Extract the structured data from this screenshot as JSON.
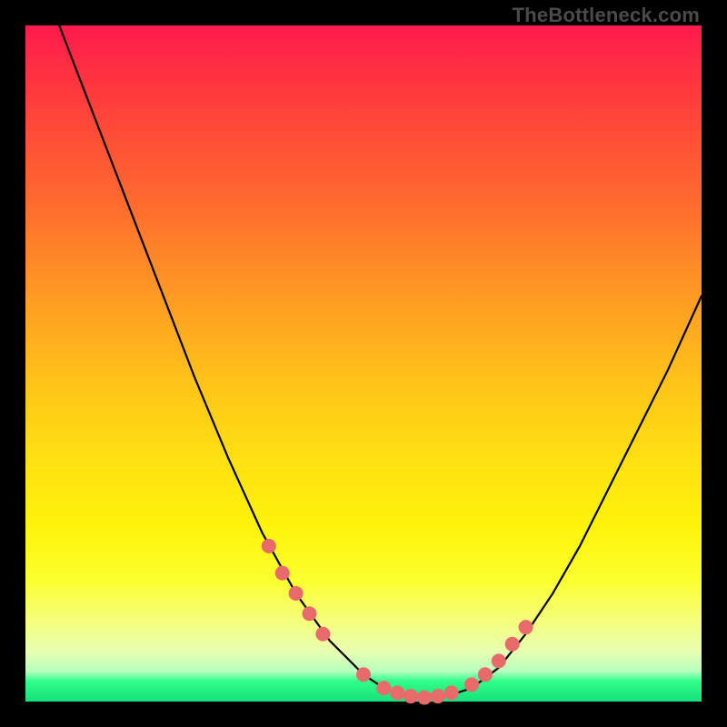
{
  "watermark": "TheBottleneck.com",
  "colors": {
    "background": "#000000",
    "curve_stroke": "#000000",
    "marker_fill": "#e96a6a",
    "marker_stroke": "#d95a5a"
  },
  "chart_data": {
    "type": "line",
    "title": "",
    "xlabel": "",
    "ylabel": "",
    "xlim": [
      0,
      100
    ],
    "ylim": [
      0,
      100
    ],
    "grid": false,
    "series": [
      {
        "name": "bottleneck-curve",
        "x": [
          5,
          10,
          15,
          20,
          25,
          30,
          35,
          40,
          45,
          50,
          53,
          56,
          58,
          60,
          63,
          66,
          70,
          74,
          78,
          82,
          86,
          90,
          95,
          100
        ],
        "y": [
          100,
          87,
          74,
          61,
          48,
          36,
          25,
          16,
          9,
          4,
          2,
          1,
          0.5,
          0.5,
          1,
          2,
          5,
          10,
          16,
          23,
          31,
          39,
          49,
          60
        ]
      }
    ],
    "markers": {
      "name": "highlight-dots",
      "x": [
        36,
        38,
        40,
        42,
        44,
        50,
        53,
        55,
        57,
        59,
        61,
        63,
        66,
        68,
        70,
        72,
        74
      ],
      "y": [
        23,
        19,
        16,
        13,
        10,
        4,
        2,
        1.3,
        0.8,
        0.6,
        0.8,
        1.3,
        2.5,
        4,
        6,
        8.5,
        11
      ]
    }
  }
}
